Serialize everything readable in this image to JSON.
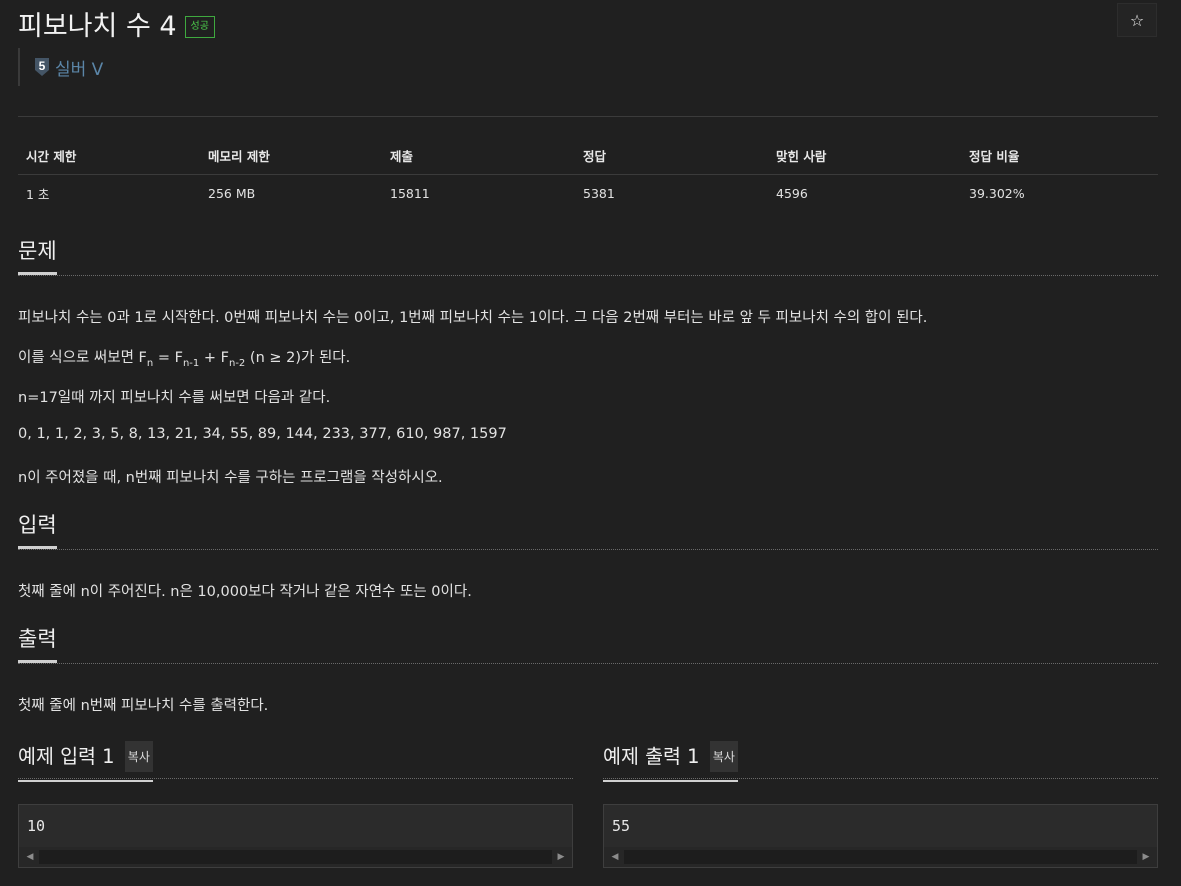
{
  "problem": {
    "title": "피보나치 수 4",
    "result_badge": "성공",
    "tier_number": "5",
    "tier_label": "실버 V",
    "star_icon": "☆"
  },
  "stats": {
    "headers": [
      "시간 제한",
      "메모리 제한",
      "제출",
      "정답",
      "맞힌 사람",
      "정답 비율"
    ],
    "values": [
      "1 초",
      "256 MB",
      "15811",
      "5381",
      "4596",
      "39.302%"
    ]
  },
  "sections": {
    "problem_heading": "문제",
    "problem_p1": "피보나치 수는 0과 1로 시작한다. 0번째 피보나치 수는 0이고, 1번째 피보나치 수는 1이다. 그 다음 2번째 부터는 바로 앞 두 피보나치 수의 합이 된다.",
    "formula": {
      "prefix": "이를 식으로 써보면 F",
      "sub1": "n",
      "mid1": " = F",
      "sub2": "n-1",
      "mid2": " + F",
      "sub3": "n-2",
      "suffix": " (n ≥ 2)가 된다."
    },
    "problem_p3": "n=17일때 까지 피보나치 수를 써보면 다음과 같다.",
    "problem_p4": "0, 1, 1, 2, 3, 5, 8, 13, 21, 34, 55, 89, 144, 233, 377, 610, 987, 1597",
    "problem_p5": "n이 주어졌을 때, n번째 피보나치 수를 구하는 프로그램을 작성하시오.",
    "input_heading": "입력",
    "input_text": "첫째 줄에 n이 주어진다. n은 10,000보다 작거나 같은 자연수 또는 0이다.",
    "output_heading": "출력",
    "output_text": "첫째 줄에 n번째 피보나치 수를 출력한다."
  },
  "samples": {
    "input_heading": "예제 입력 1",
    "output_heading": "예제 출력 1",
    "copy_label": "복사",
    "input_value": "10",
    "output_value": "55",
    "scroll_left": "◀",
    "scroll_right": "▶"
  },
  "colors": {
    "background": "#202020",
    "success": "#4bc94b",
    "tier": "#5b86a8"
  }
}
